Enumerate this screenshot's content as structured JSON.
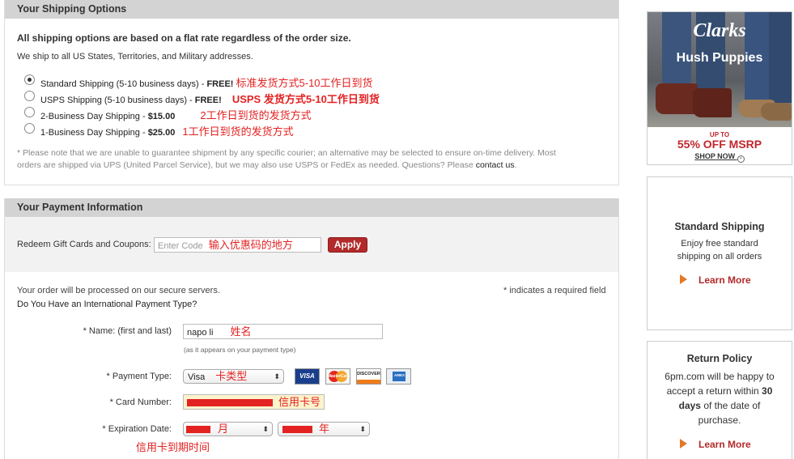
{
  "shipping": {
    "title": "Your Shipping Options",
    "flat_rate": "All shipping options are based on a flat rate regardless of the order size.",
    "we_ship": "We ship to all US States, Territories, and Military addresses.",
    "options": [
      {
        "label": "Standard Shipping (5-10 business days) - ",
        "price": "FREE!",
        "note": "标准发货方式5-10工作日到货",
        "selected": true
      },
      {
        "label": "USPS Shipping (5-10 business days) - ",
        "price": "FREE!",
        "note": "USPS 发货方式5-10工作日到货",
        "selected": false
      },
      {
        "label": "2-Business Day Shipping - ",
        "price": "$15.00",
        "note": "2工作日到货的发货方式",
        "selected": false
      },
      {
        "label": "1-Business Day Shipping - ",
        "price": "$25.00",
        "note": "1工作日到货的发货方式",
        "selected": false
      }
    ],
    "disclaimer_1": "* Please note that we are unable to guarantee shipment by any specific courier; an alternative may be selected to ensure on-time delivery. Most",
    "disclaimer_2": "orders are shipped via UPS (United Parcel Service), but we may also use USPS or FedEx as needed. Questions? Please ",
    "contact_link": "contact us",
    "disclaimer_end": "."
  },
  "payment": {
    "title": "Your Payment Information",
    "redeem_label": "Redeem Gift Cards and Coupons:",
    "code_placeholder": "Enter Code",
    "code_note": "输入优惠码的地方",
    "apply_label": "Apply",
    "secure_text": "Your order will be processed on our secure servers.",
    "required_text": "* indicates a required field",
    "intl_text": "Do You Have an International Payment Type?",
    "name_label": "* Name: (first and last)",
    "name_value": "napo li",
    "name_note": "姓名",
    "name_hint": "(as it appears on your payment type)",
    "type_label": "* Payment Type:",
    "type_value": "Visa",
    "type_note": "卡类型",
    "cards": [
      "VISA",
      "MasterCard",
      "DISCOVER",
      "AMEX"
    ],
    "card_label": "* Card Number:",
    "card_note": "信用卡号",
    "exp_label": "* Expiration Date:",
    "exp_month_note": "月",
    "exp_year_note": "年",
    "exp_note": "信用卡到期时间"
  },
  "sidebar": {
    "ad": {
      "brand1": "Clarks",
      "brand2": "Hush Puppies",
      "upto": "UP TO",
      "offer": "55% OFF MSRP",
      "cta": "SHOP NOW"
    },
    "standard": {
      "title": "Standard Shipping",
      "line1": "Enjoy free standard",
      "line2": "shipping on all orders",
      "link": "Learn More"
    },
    "returns": {
      "title": "Return Policy",
      "line1": "6pm.com will be happy to",
      "line2": "accept a return within ",
      "line2_bold": "30",
      "line3_bold": "days",
      "line3": " of the date of",
      "line4": "purchase.",
      "link": "Learn More"
    }
  },
  "colors": {
    "accent": "#b22a2a",
    "annotation": "#e32222",
    "header": "#d3d3d3"
  }
}
